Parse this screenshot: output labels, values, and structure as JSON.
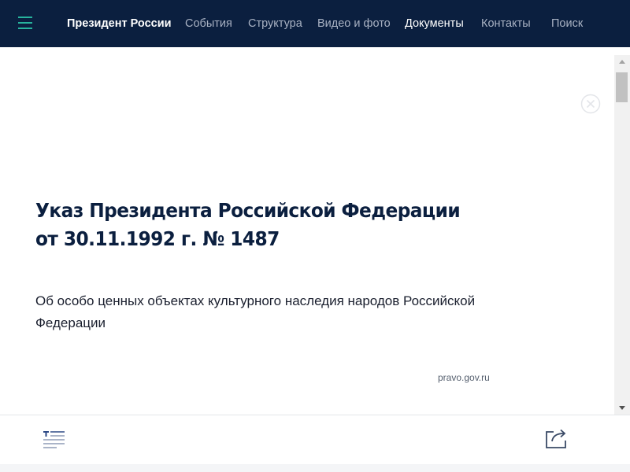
{
  "header": {
    "menu_icon": "hamburger-menu-icon",
    "brand": "Президент России",
    "nav": {
      "events": "События",
      "structure": "Структура",
      "media": "Видео и фото",
      "documents": "Документы",
      "contacts": "Контакты",
      "search": "Поиск"
    },
    "active_item": "Документы"
  },
  "document": {
    "title_line1": "Указ Президента Российской Федерации",
    "title_line2": "от 30.11.1992 г. № 1487",
    "subtitle": "Об особо ценных объектах культурного наследия народов Российской Федерации",
    "source": "pravo.gov.ru"
  },
  "toolbar": {
    "text_icon": "document-text-icon",
    "share_icon": "share-icon"
  },
  "colors": {
    "header_bg": "#0b1f3f",
    "accent": "#27b39d",
    "title": "#0b1f3f",
    "nav_inactive": "#a9b2c3"
  }
}
